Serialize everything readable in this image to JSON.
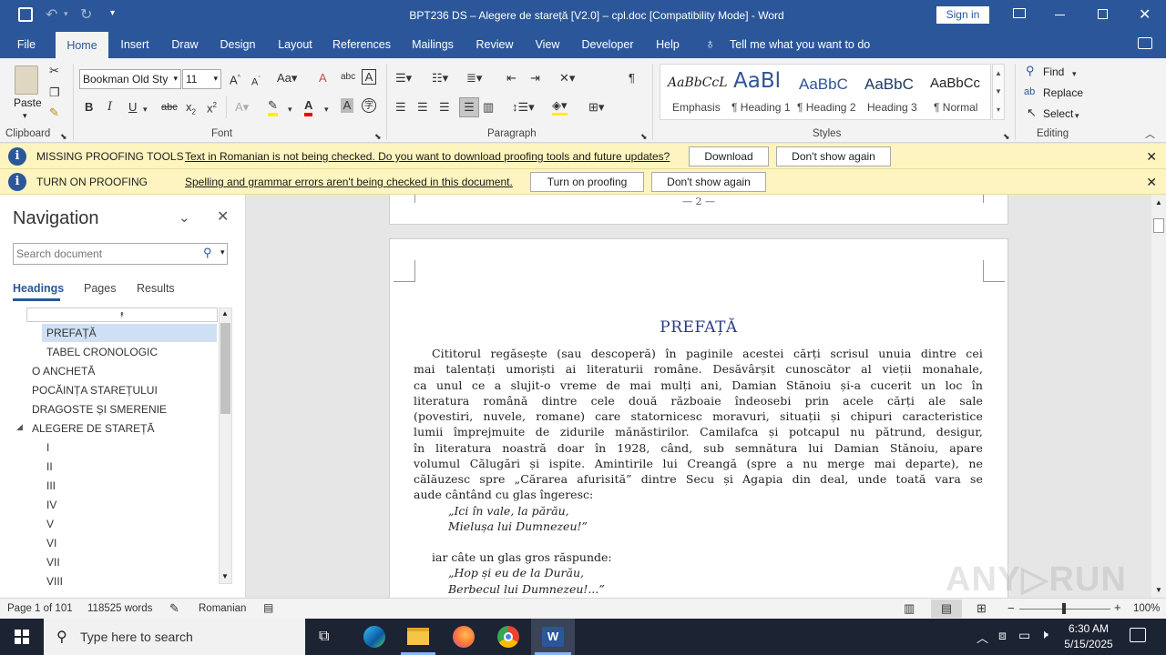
{
  "window": {
    "title": "BPT236 DS – Alegere de stareță [V2.0] – cpl.doc [Compatibility Mode] - Word",
    "sign_in": "Sign in"
  },
  "tabs": [
    "File",
    "Home",
    "Insert",
    "Draw",
    "Design",
    "Layout",
    "References",
    "Mailings",
    "Review",
    "View",
    "Developer",
    "Help"
  ],
  "tell_me": "Tell me what you want to do",
  "ribbon": {
    "clipboard": {
      "paste": "Paste",
      "label": "Clipboard"
    },
    "font": {
      "name": "Bookman Old Sty",
      "size": "11",
      "label": "Font"
    },
    "paragraph": {
      "label": "Paragraph"
    },
    "styles": {
      "label": "Styles",
      "items": [
        {
          "preview": "AaBbCcL",
          "name": "Emphasis"
        },
        {
          "preview": "AaBl",
          "name": "¶ Heading 1"
        },
        {
          "preview": "AaBbC",
          "name": "¶ Heading 2"
        },
        {
          "preview": "AaBbC",
          "name": "Heading 3"
        },
        {
          "preview": "AaBbCc",
          "name": "¶ Normal"
        }
      ]
    },
    "editing": {
      "find": "Find",
      "replace": "Replace",
      "select": "Select",
      "label": "Editing"
    }
  },
  "messages": [
    {
      "title": "MISSING PROOFING TOOLS",
      "text": "Text in Romanian is not being checked. Do you want to download proofing tools and future updates?",
      "btn1": "Download",
      "btn2": "Don't show again"
    },
    {
      "title": "TURN ON PROOFING",
      "text": "Spelling and grammar errors aren't being checked in this document.",
      "btn1": "Turn on proofing",
      "btn2": "Don't show again"
    }
  ],
  "navigation": {
    "title": "Navigation",
    "search_placeholder": "Search document",
    "tabs": [
      "Headings",
      "Pages",
      "Results"
    ],
    "items": [
      {
        "label": "PREFAȚĂ",
        "level": 2,
        "selected": true
      },
      {
        "label": "TABEL CRONOLOGIC",
        "level": 2
      },
      {
        "label": "O ANCHETĂ",
        "level": 1
      },
      {
        "label": "POCĂINȚA STAREȚULUI",
        "level": 1
      },
      {
        "label": "DRAGOSTE ȘI SMERENIE",
        "level": 1
      },
      {
        "label": "ALEGERE DE STAREȚĂ",
        "level": 1,
        "expanded": true
      },
      {
        "label": "I",
        "level": 2
      },
      {
        "label": "II",
        "level": 2
      },
      {
        "label": "III",
        "level": 2
      },
      {
        "label": "IV",
        "level": 2
      },
      {
        "label": "V",
        "level": 2
      },
      {
        "label": "VI",
        "level": 2
      },
      {
        "label": "VII",
        "level": 2
      },
      {
        "label": "VIII",
        "level": 2
      }
    ]
  },
  "document": {
    "page_number_footer": "— 2 —",
    "heading": "PREFAȚĂ",
    "lines": [
      "Cititorul regăsește (sau descoperă) în paginile acestei cărți scrisul unuia dintre cei",
      "mai talentați umoriști ai literaturii române. Desăvârșit cunoscător al vieții monahale,",
      "ca unul ce a slujit-o vreme de mai mulți ani, Damian Stănoiu și-a cucerit un loc în",
      "literatura română dintre cele două războaie îndeosebi prin acele cărți ale sale",
      "(povestiri, nuvele, romane) care statornicesc moravuri, situații și chipuri caracteristice",
      "lumii împrejmuite de zidurile mănăstirilor. Camilafca și potcapul nu pătrund, desigur,",
      "în literatura noastră doar în 1928, când, sub semnătura lui Damian Stănoiu, apare",
      "volumul Călugări și ispite. Amintirile lui Creangă (spre a nu merge mai departe), ne",
      "călăuzesc spre „Cărarea afurisită” dintre Secu și Agapia din deal, unde toată vara se"
    ],
    "line_last": "aude cântând cu glas îngeresc:",
    "verse1": [
      "„Ici în vale, la părău,",
      "Mielușa lui Dumnezeu!”"
    ],
    "line_after": "iar câte un glas gros răspunde:",
    "verse2": [
      "„Hop și eu de la Durău,",
      "Berbecul lui Dumnezeu!...”"
    ]
  },
  "status": {
    "page": "Page 1 of 101",
    "words": "118525 words",
    "language": "Romanian",
    "zoom": "100%"
  },
  "taskbar": {
    "search_placeholder": "Type here to search",
    "time": "6:30 AM",
    "date": "5/15/2025"
  },
  "watermark": "ANY RUN"
}
